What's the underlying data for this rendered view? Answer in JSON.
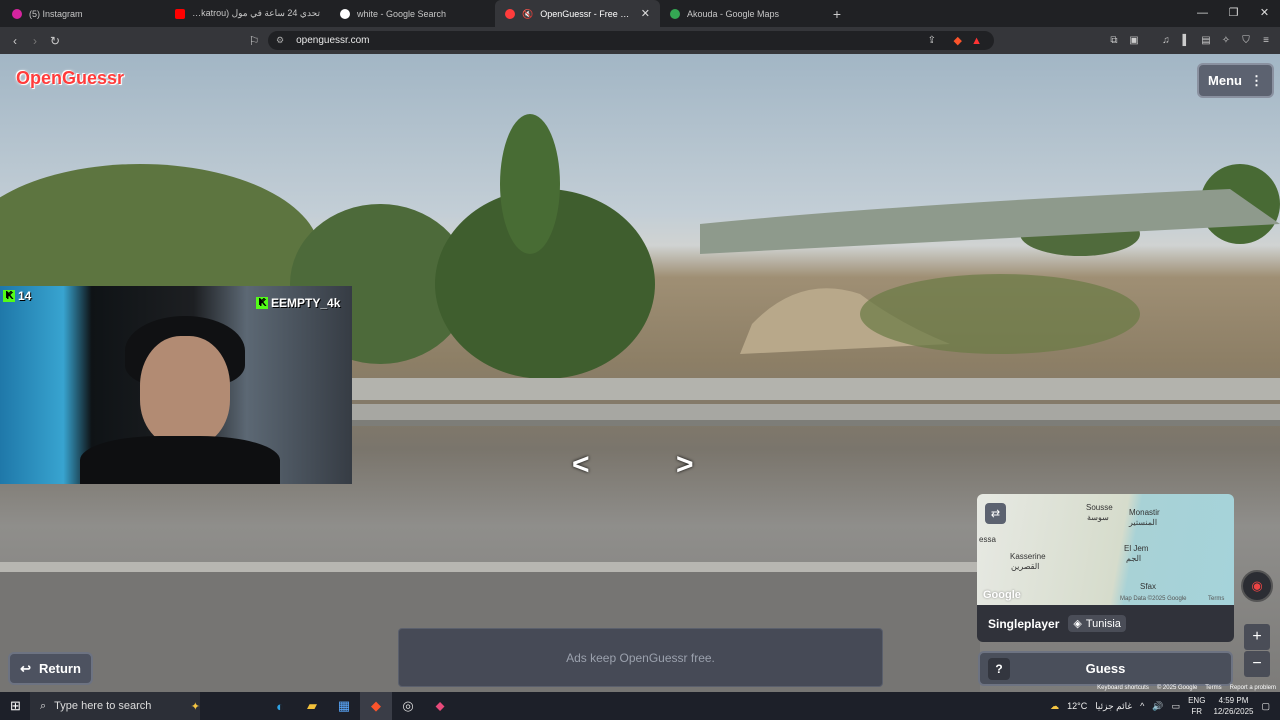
{
  "browser": {
    "tabs": [
      {
        "title": "(5) Instagram",
        "favicon_color": "#d6249f",
        "active": false
      },
      {
        "title": "تحدي 24 ساعة في مول (amen, katrou",
        "favicon_color": "#ff0000",
        "active": false
      },
      {
        "title": "white - Google Search",
        "favicon_color": "#ffffff",
        "active": false
      },
      {
        "title": "OpenGuessr - Free GeoGuess",
        "favicon_color": "#ff3c3c",
        "active": true
      },
      {
        "title": "Akouda - Google Maps",
        "favicon_color": "#34a853",
        "active": false
      }
    ],
    "new_tab": "+",
    "url": "openguessr.com",
    "window_controls": [
      "—",
      "❐",
      "✕"
    ]
  },
  "game": {
    "logo": "OpenGuessr",
    "menu_label": "Menu",
    "menu_icon": "⋮",
    "pan_left": "<",
    "pan_right": ">",
    "mode": "Singleplayer",
    "country": "Tunisia",
    "guess_help": "?",
    "guess_label": "Guess",
    "return_label": "Return",
    "ad_text": "Ads keep OpenGuessr free.",
    "zoom_in": "+",
    "zoom_out": "−",
    "google_watermark": "Google",
    "footer": [
      "Keyboard shortcuts",
      "© 2025 Google",
      "Terms",
      "Report a problem"
    ]
  },
  "minimap": {
    "labels": [
      {
        "text": "Sousse",
        "sub": "سوسة"
      },
      {
        "text": "Monastir",
        "sub": "المنستير"
      },
      {
        "text": "El Jem",
        "sub": "الجم"
      },
      {
        "text": "Kasserine",
        "sub": "القصرين"
      },
      {
        "text": "Sfax",
        "sub": "صفاقس"
      },
      {
        "text": "essa",
        "sub": ""
      }
    ],
    "map_data": "Map Data ©2025 Google",
    "terms": "Terms"
  },
  "stream": {
    "viewer_count": "14",
    "channel_name": "EEMPTY_4k"
  },
  "taskbar": {
    "search_placeholder": "Type here to search",
    "weather": "12°C",
    "weather_text": "غائم جزئيا",
    "lang_top": "ENG",
    "lang_bottom": "FR",
    "time": "4:59 PM",
    "date": "12/26/2025"
  }
}
